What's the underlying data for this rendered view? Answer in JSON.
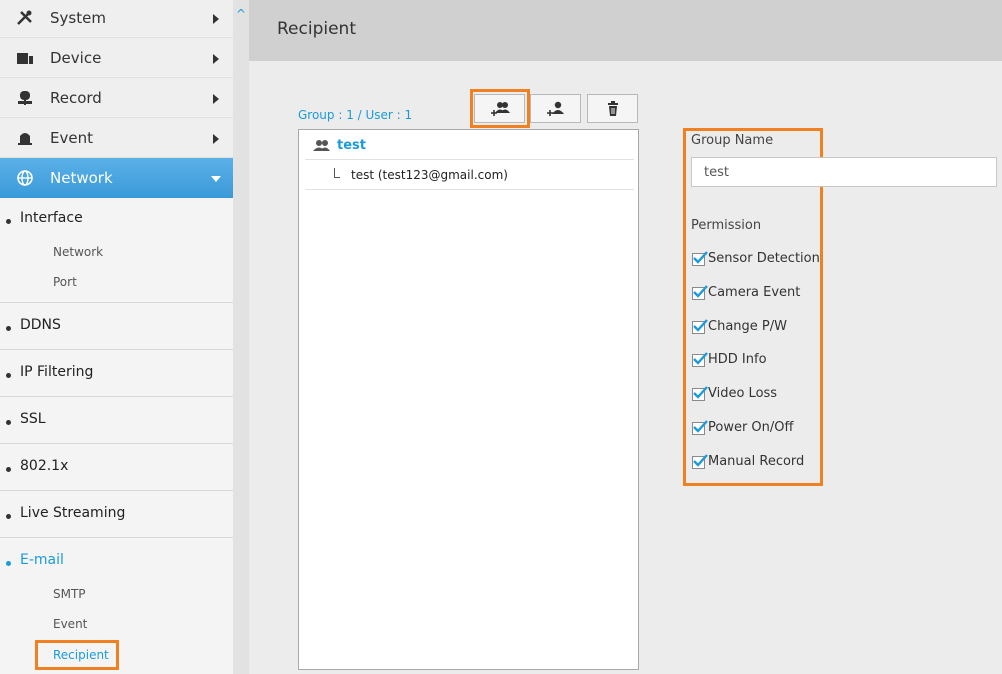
{
  "sidebar": {
    "menu": [
      {
        "label": "System",
        "icon": "tools-icon"
      },
      {
        "label": "Device",
        "icon": "device-icon"
      },
      {
        "label": "Record",
        "icon": "record-icon"
      },
      {
        "label": "Event",
        "icon": "event-icon"
      },
      {
        "label": "Network",
        "icon": "globe-icon",
        "active": true
      }
    ],
    "sections": {
      "interface": "Interface",
      "interface_network": "Network",
      "interface_port": "Port",
      "ddns": "DDNS",
      "ip_filtering": "IP Filtering",
      "ssl": "SSL",
      "dot1x": "802.1x",
      "live_streaming": "Live Streaming",
      "email": "E-mail",
      "email_smtp": "SMTP",
      "email_event": "Event",
      "email_recipient": "Recipient"
    }
  },
  "header": {
    "title": "Recipient"
  },
  "recipients": {
    "count_text": "Group : 1 / User : 1",
    "toolbar": [
      "add-group-icon",
      "add-user-icon",
      "delete-icon"
    ],
    "group": "test",
    "user": "test (test123@gmail.com)"
  },
  "group_panel": {
    "name_label": "Group Name",
    "name_value": "test",
    "permission_label": "Permission",
    "permissions": [
      {
        "label": "Sensor Detection",
        "checked": true
      },
      {
        "label": "Camera Event",
        "checked": true
      },
      {
        "label": "Change P/W",
        "checked": true
      },
      {
        "label": "HDD Info",
        "checked": true
      },
      {
        "label": "Video Loss",
        "checked": true
      },
      {
        "label": "Power On/Off",
        "checked": true
      },
      {
        "label": "Manual Record",
        "checked": true
      }
    ]
  },
  "colors": {
    "accent": "#1a9bdc",
    "highlight": "#f08020"
  }
}
